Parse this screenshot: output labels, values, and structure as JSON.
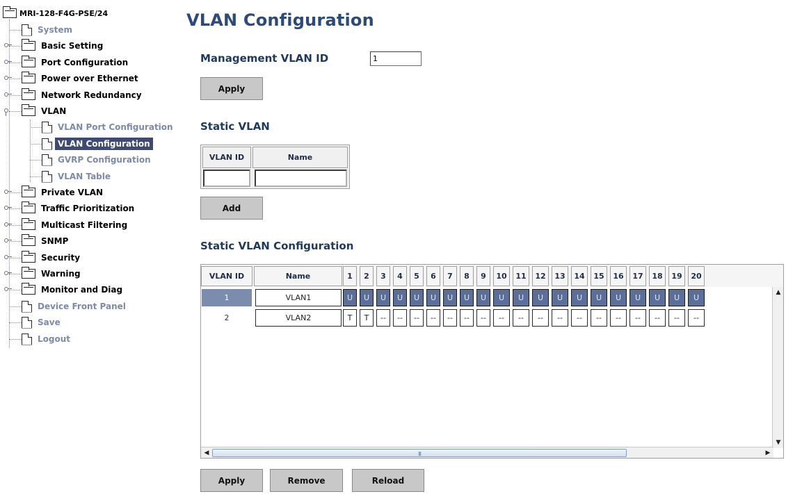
{
  "sidebar": {
    "root_label": "MRI-128-F4G-PSE/24",
    "items": [
      {
        "label": "System",
        "type": "page",
        "depth": 1
      },
      {
        "label": "Basic Setting",
        "type": "folder",
        "depth": 1
      },
      {
        "label": "Port Configuration",
        "type": "folder",
        "depth": 1
      },
      {
        "label": "Power over Ethernet",
        "type": "folder",
        "depth": 1
      },
      {
        "label": "Network Redundancy",
        "type": "folder",
        "depth": 1
      },
      {
        "label": "VLAN",
        "type": "folder",
        "depth": 1,
        "expanded": true
      },
      {
        "label": "VLAN Port Configuration",
        "type": "page",
        "depth": 2
      },
      {
        "label": "VLAN Configuration",
        "type": "page",
        "depth": 2,
        "selected": true
      },
      {
        "label": "GVRP Configuration",
        "type": "page",
        "depth": 2
      },
      {
        "label": "VLAN Table",
        "type": "page",
        "depth": 2
      },
      {
        "label": "Private VLAN",
        "type": "folder",
        "depth": 1
      },
      {
        "label": "Traffic Prioritization",
        "type": "folder",
        "depth": 1
      },
      {
        "label": "Multicast Filtering",
        "type": "folder",
        "depth": 1
      },
      {
        "label": "SNMP",
        "type": "folder",
        "depth": 1
      },
      {
        "label": "Security",
        "type": "folder",
        "depth": 1
      },
      {
        "label": "Warning",
        "type": "folder",
        "depth": 1
      },
      {
        "label": "Monitor and Diag",
        "type": "folder",
        "depth": 1
      },
      {
        "label": "Device Front Panel",
        "type": "page",
        "depth": 1
      },
      {
        "label": "Save",
        "type": "page",
        "depth": 1
      },
      {
        "label": "Logout",
        "type": "page",
        "depth": 1
      }
    ]
  },
  "main": {
    "page_title": "VLAN Configuration",
    "management_vlan": {
      "label": "Management VLAN ID",
      "value": "1",
      "apply_label": "Apply"
    },
    "static_vlan": {
      "title": "Static VLAN",
      "columns": [
        "VLAN ID",
        "Name"
      ],
      "vlan_id_value": "",
      "name_value": "",
      "add_label": "Add"
    },
    "static_vlan_config": {
      "title": "Static VLAN Configuration",
      "columns": [
        "VLAN ID",
        "Name",
        "1",
        "2",
        "3",
        "4",
        "5",
        "6",
        "7",
        "8",
        "9",
        "10",
        "11",
        "12",
        "13",
        "14",
        "15",
        "16",
        "17",
        "18",
        "19",
        "20"
      ],
      "rows": [
        {
          "vlan_id": "1",
          "name": "VLAN1",
          "ports": [
            "U",
            "U",
            "U",
            "U",
            "U",
            "U",
            "U",
            "U",
            "U",
            "U",
            "U",
            "U",
            "U",
            "U",
            "U",
            "U",
            "U",
            "U",
            "U",
            "U"
          ],
          "selected": true
        },
        {
          "vlan_id": "2",
          "name": "VLAN2",
          "ports": [
            "T",
            "T",
            "--",
            "--",
            "--",
            "--",
            "--",
            "--",
            "--",
            "--",
            "--",
            "--",
            "--",
            "--",
            "--",
            "--",
            "--",
            "--",
            "--",
            "--"
          ],
          "selected": false
        }
      ],
      "scroll_grip": "III"
    },
    "buttons": {
      "apply_label": "Apply",
      "remove_label": "Remove",
      "reload_label": "Reload"
    }
  },
  "colors": {
    "title": "#2d4a78",
    "selection": "#3d4a73",
    "selected_row": "#5c6f99",
    "button": "#c8c8c8",
    "page_link": "#7d8aa9"
  }
}
